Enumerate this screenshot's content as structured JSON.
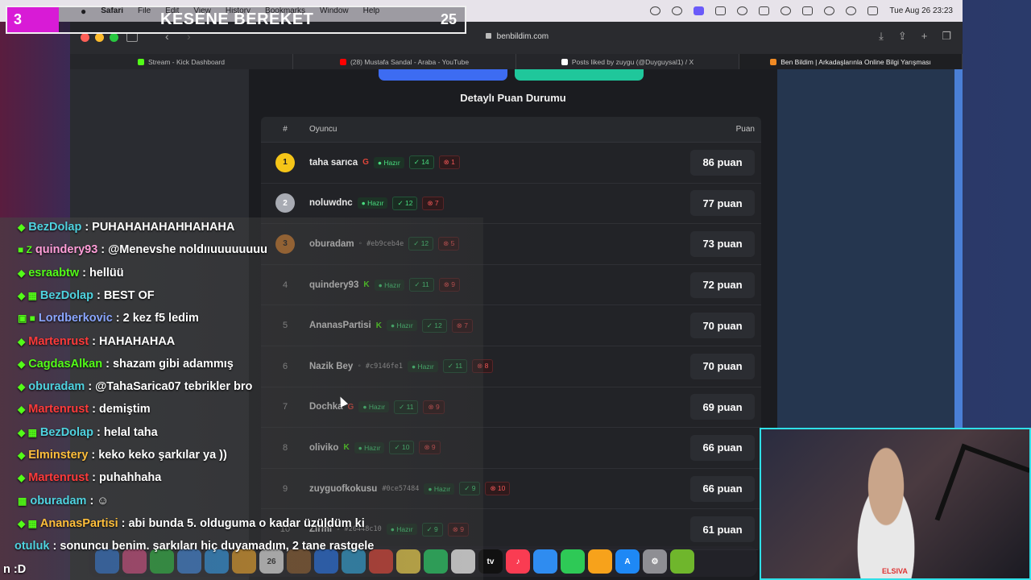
{
  "menubar": {
    "app": "Safari",
    "items": [
      "File",
      "Edit",
      "View",
      "History",
      "Bookmarks",
      "Window",
      "Help"
    ],
    "clock": "Tue Aug 26  23:23"
  },
  "browser": {
    "url": "benbildim.com",
    "tabs": [
      {
        "label": "Stream - Kick Dashboard",
        "fav_color": "#53fc18"
      },
      {
        "label": "(28) Mustafa Sandal - Araba - YouTube",
        "fav_color": "#ff0000"
      },
      {
        "label": "Posts liked by zuygu (@Duyguysal1) / X",
        "fav_color": "#ffffff"
      },
      {
        "label": "Ben Bildim | Arkadaşlarınla Online Bilgi Yarışması",
        "fav_color": "#f08a24"
      }
    ]
  },
  "page": {
    "section_title": "Detaylı Puan Durumu",
    "headers": {
      "rank": "#",
      "player": "Oyuncu",
      "score": "Puan"
    },
    "rows": [
      {
        "rank": "1",
        "name": "taha sarıca",
        "provider": "G",
        "ptype": "g",
        "id": "",
        "ready": "Hazır",
        "correct": "14",
        "wrong": "1",
        "score": "86 puan",
        "medal": "gold"
      },
      {
        "rank": "2",
        "name": "noluwdnc",
        "provider": "",
        "ptype": "",
        "id": "",
        "ready": "Hazır",
        "correct": "12",
        "wrong": "7",
        "score": "77 puan",
        "medal": "silver"
      },
      {
        "rank": "3",
        "name": "oburadam",
        "provider": "◦",
        "ptype": "u",
        "id": "#eb9ceb4e",
        "ready": "",
        "correct": "12",
        "wrong": "5",
        "score": "73 puan",
        "medal": "bronze"
      },
      {
        "rank": "4",
        "name": "quindery93",
        "provider": "K",
        "ptype": "k",
        "id": "",
        "ready": "Hazır",
        "correct": "11",
        "wrong": "9",
        "score": "72 puan",
        "medal": ""
      },
      {
        "rank": "5",
        "name": "AnanasPartisi",
        "provider": "K",
        "ptype": "k",
        "id": "",
        "ready": "Hazır",
        "correct": "12",
        "wrong": "7",
        "score": "70 puan",
        "medal": ""
      },
      {
        "rank": "6",
        "name": "Nazik Bey",
        "provider": "◦",
        "ptype": "u",
        "id": "#c9146fe1",
        "ready": "Hazır",
        "correct": "11",
        "wrong": "8",
        "score": "70 puan",
        "medal": ""
      },
      {
        "rank": "7",
        "name": "Dochka",
        "provider": "G",
        "ptype": "g",
        "id": "",
        "ready": "Hazır",
        "correct": "11",
        "wrong": "9",
        "score": "69 puan",
        "medal": ""
      },
      {
        "rank": "8",
        "name": "oliviko",
        "provider": "K",
        "ptype": "k",
        "id": "",
        "ready": "Hazır",
        "correct": "10",
        "wrong": "9",
        "score": "66 puan",
        "medal": ""
      },
      {
        "rank": "9",
        "name": "zuyguofkokusu",
        "provider": "",
        "ptype": "",
        "id": "#0ce57484",
        "ready": "Hazır",
        "correct": "9",
        "wrong": "10",
        "score": "66 puan",
        "medal": ""
      },
      {
        "rank": "10",
        "name": "Zirmi",
        "provider": "◦",
        "ptype": "u",
        "id": "#26448c10",
        "ready": "Hazır",
        "correct": "9",
        "wrong": "9",
        "score": "61 puan",
        "medal": ""
      }
    ]
  },
  "overlay": {
    "counter_left": "3",
    "counter_title": "KESENE BEREKET",
    "counter_right": "25"
  },
  "chat": [
    {
      "user": "BezDolap",
      "color": "#4fd3e0",
      "badge": "◆",
      "text": "PUHAHAHAHAHHAHAHA"
    },
    {
      "user": "quindery93",
      "color": "#ff9ed8",
      "badge": "■ Z",
      "text": "@Menevshe noldııuuuuuuuu"
    },
    {
      "user": "esraabtw",
      "color": "#53fc18",
      "badge": "◆",
      "text": "hellüü"
    },
    {
      "user": "BezDolap",
      "color": "#4fd3e0",
      "badge": "◆ ▦",
      "text": "BEST OF"
    },
    {
      "user": "Lordberkovic",
      "color": "#8aa6ff",
      "badge": "▣ ■",
      "text": "2 kez f5 ledim"
    },
    {
      "user": "Martenrust",
      "color": "#ff3b3b",
      "badge": "◆",
      "text": "HAHAHAHAA"
    },
    {
      "user": "CagdasAlkan",
      "color": "#53fc18",
      "badge": "◆",
      "text": "shazam gibi adammış"
    },
    {
      "user": "oburadam",
      "color": "#4fd3e0",
      "badge": "◆",
      "text": "@TahaSarica07 tebrikler bro"
    },
    {
      "user": "Martenrust",
      "color": "#ff3b3b",
      "badge": "◆",
      "text": "demiştim"
    },
    {
      "user": "BezDolap",
      "color": "#4fd3e0",
      "badge": "◆ ▦",
      "text": "helal taha"
    },
    {
      "user": "Elminstery",
      "color": "#ffbf3b",
      "badge": "◆",
      "text": "keko keko şarkılar ya ))"
    },
    {
      "user": "Martenrust",
      "color": "#ff3b3b",
      "badge": "◆",
      "text": "puhahhaha"
    },
    {
      "user": "oburadam",
      "color": "#4fd3e0",
      "badge": "▦",
      "text": "☺"
    },
    {
      "user": "AnanasPartisi",
      "color": "#ffbf3b",
      "badge": "◆ ▦",
      "text": "abi bunda 5. olduguma o kadar üzüldüm ki"
    },
    {
      "user": "otuluk",
      "color": "#4fd3e0",
      "badge": "",
      "text": "sonuncu benim. şarkıları hiç duyamadım, 2 tane rastgele"
    },
    {
      "user": "",
      "color": "#ffffff",
      "badge": "",
      "text": "n :D"
    }
  ],
  "webcam": {
    "label": "ELSIVA"
  },
  "dock": {
    "icons": [
      {
        "name": "finder",
        "color": "#2b7de9",
        "glyph": ""
      },
      {
        "name": "launchpad",
        "color": "#e94b8a",
        "glyph": ""
      },
      {
        "name": "messages",
        "color": "#28c840",
        "glyph": ""
      },
      {
        "name": "mail",
        "color": "#3b8df0",
        "glyph": ""
      },
      {
        "name": "safari",
        "color": "#2a9df4",
        "glyph": ""
      },
      {
        "name": "photos",
        "color": "#f5a623",
        "glyph": ""
      },
      {
        "name": "calendar",
        "color": "#f4f4f4",
        "glyph": "26"
      },
      {
        "name": "notes-app",
        "color": "#8b5a2b",
        "glyph": ""
      },
      {
        "name": "xcode",
        "color": "#1f6feb",
        "glyph": ""
      },
      {
        "name": "telegram",
        "color": "#2aa1da",
        "glyph": ""
      },
      {
        "name": "chrome",
        "color": "#e34133",
        "glyph": ""
      },
      {
        "name": "notes",
        "color": "#f7d84a",
        "glyph": ""
      },
      {
        "name": "whatsapp",
        "color": "#25d366",
        "glyph": ""
      },
      {
        "name": "freeform",
        "color": "#ffffff",
        "glyph": ""
      },
      {
        "name": "appletv",
        "color": "#111111",
        "glyph": "tv"
      },
      {
        "name": "music",
        "color": "#fa3c52",
        "glyph": "♪"
      },
      {
        "name": "keynote",
        "color": "#2f8cf0",
        "glyph": ""
      },
      {
        "name": "numbers",
        "color": "#2ec956",
        "glyph": ""
      },
      {
        "name": "pages",
        "color": "#f7a21b",
        "glyph": ""
      },
      {
        "name": "appstore",
        "color": "#1e88f5",
        "glyph": "A"
      },
      {
        "name": "settings",
        "color": "#8e8e93",
        "glyph": "⚙"
      },
      {
        "name": "obs",
        "color": "#6fb62c",
        "glyph": ""
      }
    ]
  }
}
